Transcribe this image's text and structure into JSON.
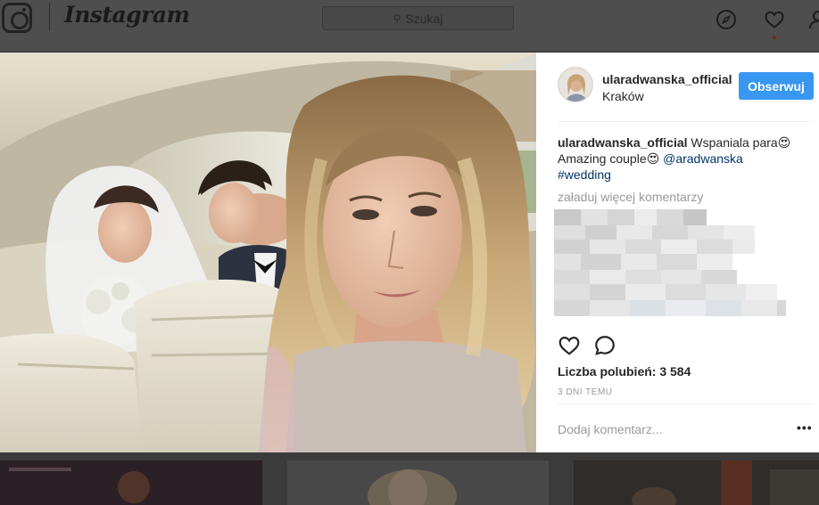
{
  "header": {
    "wordmark": "Instagram",
    "search_placeholder": "Szukaj",
    "search_icon": "magnifier-icon",
    "nav_icons": [
      "compass-icon",
      "heart-icon",
      "user-icon"
    ]
  },
  "post": {
    "username": "ularadwanska_official",
    "location": "Kraków",
    "follow_label": "Obserwuj",
    "caption": {
      "username": "ularadwanska_official",
      "text": " Wspaniala para😍Amazing couple😍 ",
      "mention": "@aradwanska",
      "hashtag": "#wedding"
    },
    "load_more_comments": "załaduj więcej komentarzy",
    "likes": "Liczba polubień: 3 584",
    "timestamp": "3 DNI TEMU",
    "add_comment_placeholder": "Dodaj komentarz...",
    "more_options": "•••",
    "action_icons": [
      "heart-icon",
      "comment-icon"
    ]
  },
  "colors": {
    "follow_button": "#3897f0",
    "link": "#003569",
    "muted_text": "#999999",
    "overlay": "#3b3b3b"
  }
}
